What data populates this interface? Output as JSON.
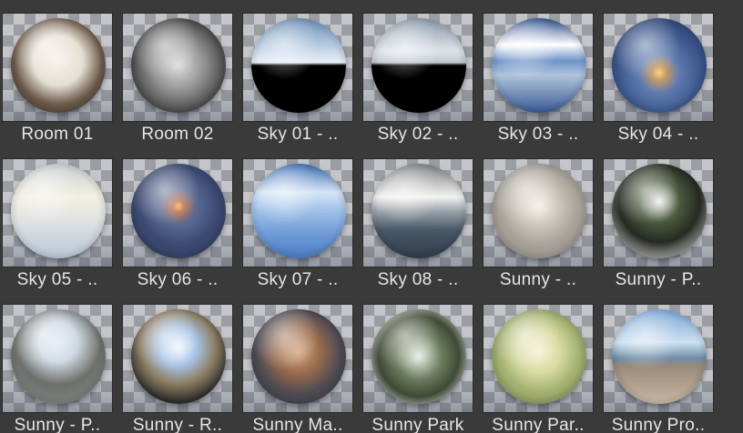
{
  "browser": {
    "items": [
      {
        "label": "Room 01",
        "icon": "room-01-hdri-thumbnail",
        "style": "s-room1"
      },
      {
        "label": "Room 02",
        "icon": "room-02-hdri-thumbnail",
        "style": "s-room2"
      },
      {
        "label": "Sky 01 - ..",
        "icon": "sky-01-hdri-thumbnail",
        "style": "s-sky1"
      },
      {
        "label": "Sky 02 - ..",
        "icon": "sky-02-hdri-thumbnail",
        "style": "s-sky2"
      },
      {
        "label": "Sky 03 - ..",
        "icon": "sky-03-hdri-thumbnail",
        "style": "s-sky3"
      },
      {
        "label": "Sky 04 - ..",
        "icon": "sky-04-hdri-thumbnail",
        "style": "s-sky4"
      },
      {
        "label": "Sky 05 - ..",
        "icon": "sky-05-hdri-thumbnail",
        "style": "s-sky5"
      },
      {
        "label": "Sky 06 - ..",
        "icon": "sky-06-hdri-thumbnail",
        "style": "s-sky6"
      },
      {
        "label": "Sky 07 - ..",
        "icon": "sky-07-hdri-thumbnail",
        "style": "s-sky7"
      },
      {
        "label": "Sky 08 - ..",
        "icon": "sky-08-hdri-thumbnail",
        "style": "s-sky8"
      },
      {
        "label": "Sunny - ..",
        "icon": "sunny-hdri-thumbnail",
        "style": "s-sunny1"
      },
      {
        "label": "Sunny - P..",
        "icon": "sunny-p-hdri-thumbnail",
        "style": "s-sunny2"
      },
      {
        "label": "Sunny - P..",
        "icon": "sunny-p-2-hdri-thumbnail",
        "style": "s-sunny3"
      },
      {
        "label": "Sunny - R..",
        "icon": "sunny-r-hdri-thumbnail",
        "style": "s-sunny4"
      },
      {
        "label": "Sunny Ma..",
        "icon": "sunny-ma-hdri-thumbnail",
        "style": "s-sunnyma"
      },
      {
        "label": "Sunny Park",
        "icon": "sunny-park-hdri-thumbnail",
        "style": "s-park"
      },
      {
        "label": "Sunny Par..",
        "icon": "sunny-par-hdri-thumbnail",
        "style": "s-park2"
      },
      {
        "label": "Sunny Pro..",
        "icon": "sunny-pro-hdri-thumbnail",
        "style": "s-pro"
      }
    ]
  }
}
